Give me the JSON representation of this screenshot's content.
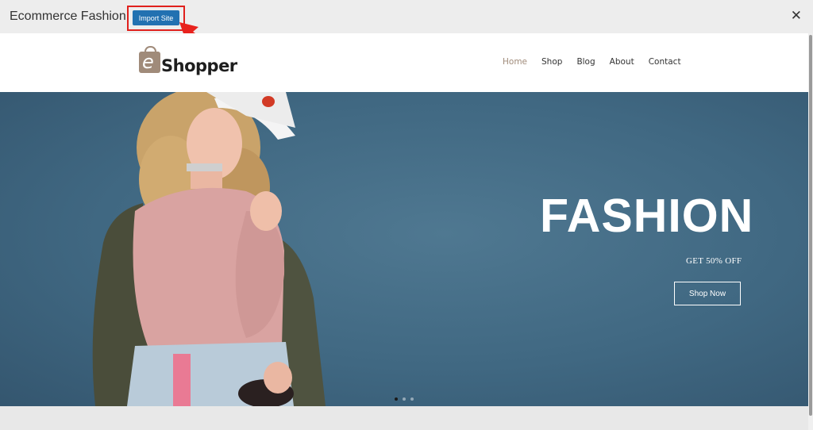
{
  "topbar": {
    "title": "Ecommerce Fashion",
    "import_label": "Import Site",
    "close_glyph": "✕"
  },
  "site": {
    "logo": {
      "mark": "e",
      "text": "Shopper"
    },
    "nav": [
      {
        "label": "Home",
        "active": true
      },
      {
        "label": "Shop",
        "active": false
      },
      {
        "label": "Blog",
        "active": false
      },
      {
        "label": "About",
        "active": false
      },
      {
        "label": "Contact",
        "active": false
      }
    ],
    "hero": {
      "title": "FASHION",
      "subtitle": "GET 50% OFF",
      "cta_label": "Shop Now",
      "slides": 3,
      "active_slide": 1
    }
  },
  "colors": {
    "accent": "#a08b7a",
    "import_button": "#2271b1",
    "highlight": "#e0201c",
    "hero_bg": "#436c86"
  },
  "icons": [
    "close-icon",
    "arrow-pointer-icon",
    "shopping-bag-icon"
  ]
}
